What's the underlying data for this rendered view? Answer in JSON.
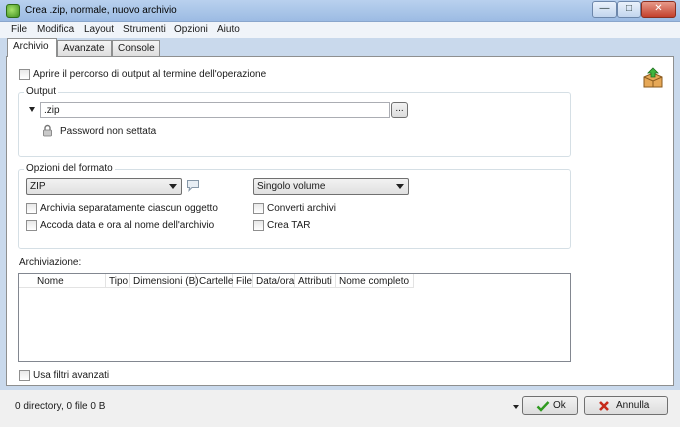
{
  "window": {
    "title": "Crea .zip, normale, nuovo archivio"
  },
  "menu": [
    "File",
    "Modifica",
    "Layout",
    "Strumenti",
    "Opzioni",
    "Aiuto"
  ],
  "tabs": [
    "Archivio",
    "Avanzate",
    "Console"
  ],
  "archivio": {
    "open_output_label": "Aprire il percorso di output al termine dell'operazione",
    "output": {
      "legend": "Output",
      "path_value": ".zip",
      "browse_label": "...",
      "password_status": "Password non settata"
    },
    "format": {
      "legend": "Opzioni del formato",
      "format_selected": "ZIP",
      "volume_selected": "Singolo volume",
      "archive_separately_label": "Archivia separatamente ciascun oggetto",
      "append_date_label": "Accoda data e ora al nome dell'archivio",
      "convert_label": "Converti archivi",
      "create_tar_label": "Crea TAR"
    },
    "archive_list": {
      "label": "Archiviazione:",
      "columns": [
        "Nome",
        "Tipo",
        "Dimensioni (B)",
        "Cartelle",
        "File",
        "Data/ora",
        "Attributi",
        "Nome completo"
      ]
    },
    "advanced_filters_label": "Usa filtri avanzati"
  },
  "status": {
    "summary": "0 directory, 0 file 0 B",
    "ok_label": "Ok",
    "cancel_label": "Annulla"
  },
  "colors": {
    "ok_check": "#2f9a1f",
    "cancel_x": "#c62a1a"
  }
}
